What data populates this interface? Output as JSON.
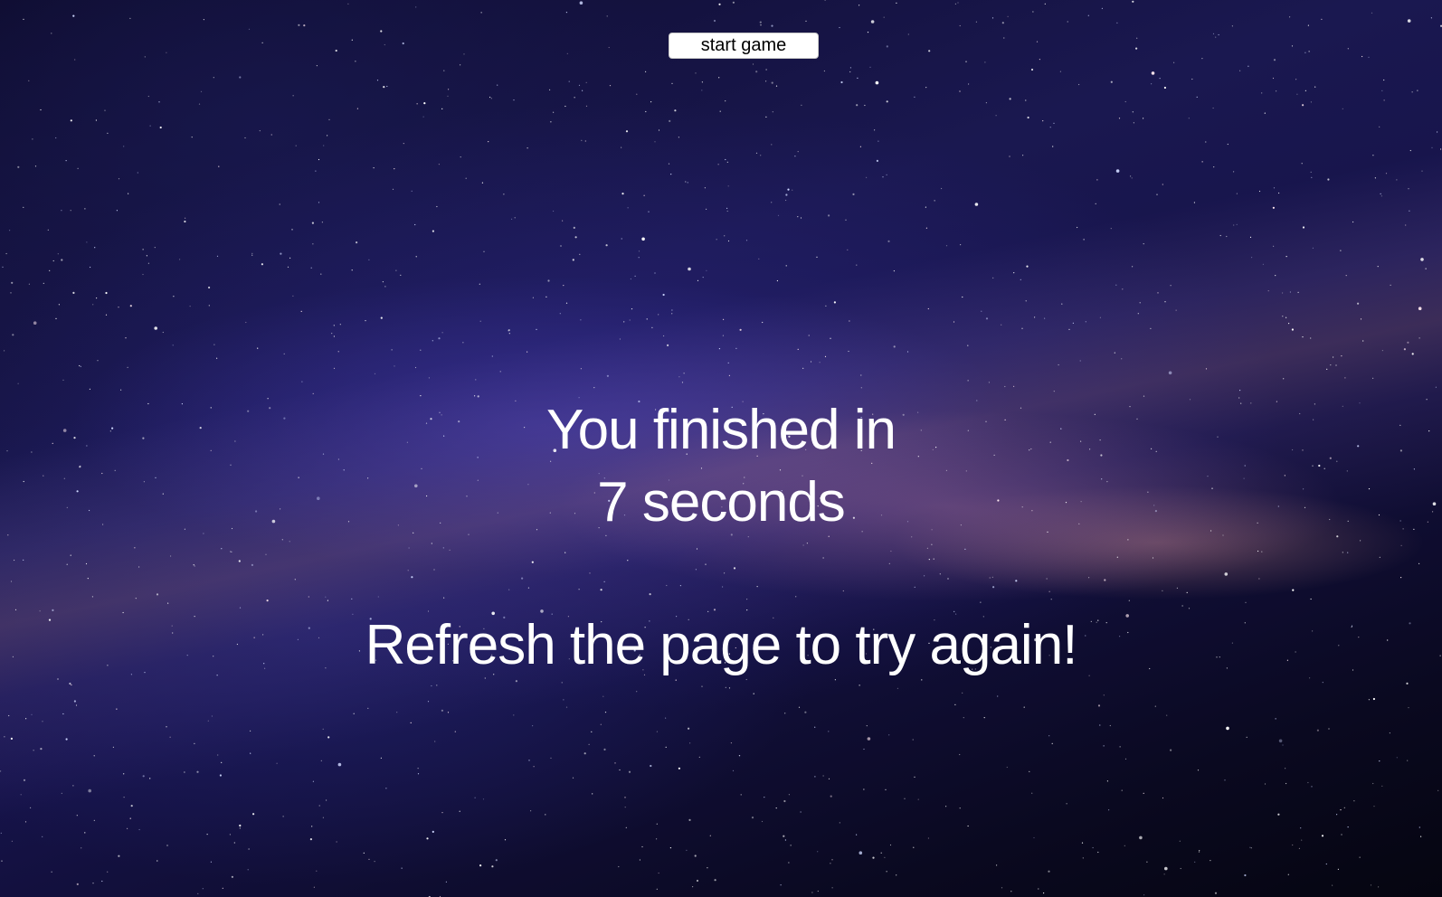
{
  "game": {
    "start_button_label": "start game",
    "result_line_1": "You finished in",
    "result_line_2": "7 seconds",
    "retry_message": "Refresh the page to try again!"
  },
  "colors": {
    "text": "#ffffff",
    "button_bg": "#ffffff",
    "sky_dark": "#05050f",
    "sky_blue": "#1a1850"
  }
}
